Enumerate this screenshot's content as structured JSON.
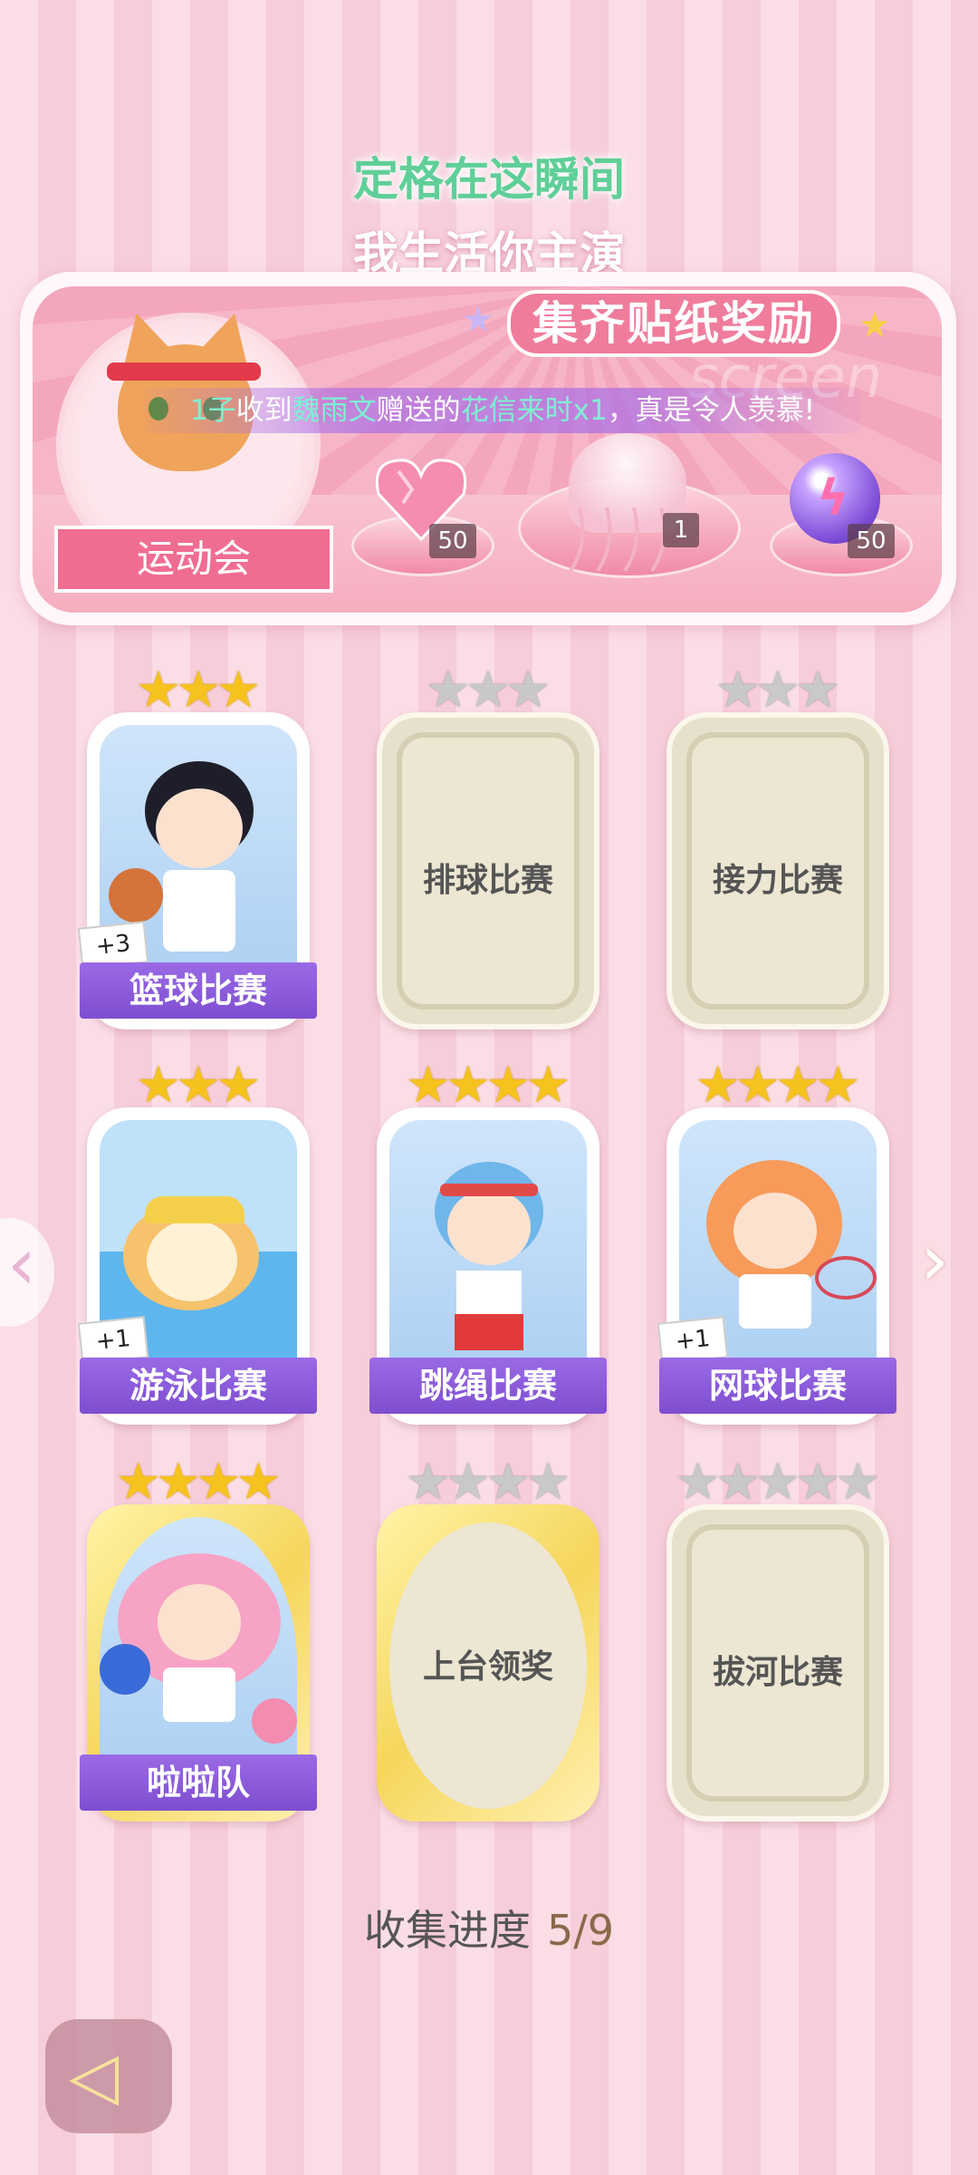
{
  "header": {
    "title": "定格在这瞬间",
    "subtitle": "我生活你主演"
  },
  "banner": {
    "reward_title": "集齐贴纸奖励",
    "theme_label": "运动会",
    "watermark": "screen",
    "marquee": {
      "prefix": "1子",
      "part1": "收到",
      "sender": "魏雨文",
      "part2": "赠送的",
      "gift": "花信来时x1",
      "part3": "，真是令人羡慕!"
    },
    "rewards": [
      {
        "icon": "heart-gem-icon",
        "count": "50"
      },
      {
        "icon": "jellyfish-icon",
        "count": "1"
      },
      {
        "icon": "energy-orb-icon",
        "count": "50"
      }
    ]
  },
  "cards": [
    {
      "name": "篮球比赛",
      "stars_filled": 3,
      "stars_total": 3,
      "collected": true,
      "bonus": "+3"
    },
    {
      "name": "排球比赛",
      "stars_filled": 0,
      "stars_total": 3,
      "collected": false
    },
    {
      "name": "接力比赛",
      "stars_filled": 0,
      "stars_total": 3,
      "collected": false
    },
    {
      "name": "游泳比赛",
      "stars_filled": 3,
      "stars_total": 3,
      "collected": true,
      "bonus": "+1"
    },
    {
      "name": "跳绳比赛",
      "stars_filled": 4,
      "stars_total": 4,
      "collected": true
    },
    {
      "name": "网球比赛",
      "stars_filled": 4,
      "stars_total": 4,
      "collected": true,
      "bonus": "+1"
    },
    {
      "name": "啦啦队",
      "stars_filled": 4,
      "stars_total": 4,
      "collected": true
    },
    {
      "name": "上台领奖",
      "stars_filled": 0,
      "stars_total": 4,
      "collected": false
    },
    {
      "name": "拔河比赛",
      "stars_filled": 0,
      "stars_total": 5,
      "collected": false
    }
  ],
  "progress": {
    "label": "收集进度",
    "value": "5/9"
  },
  "colors": {
    "accent_green": "#5fcf98",
    "ribbon_purple": "#8a5bdc",
    "star_gold": "#f6c21e",
    "star_grey": "#c9c9c9"
  }
}
